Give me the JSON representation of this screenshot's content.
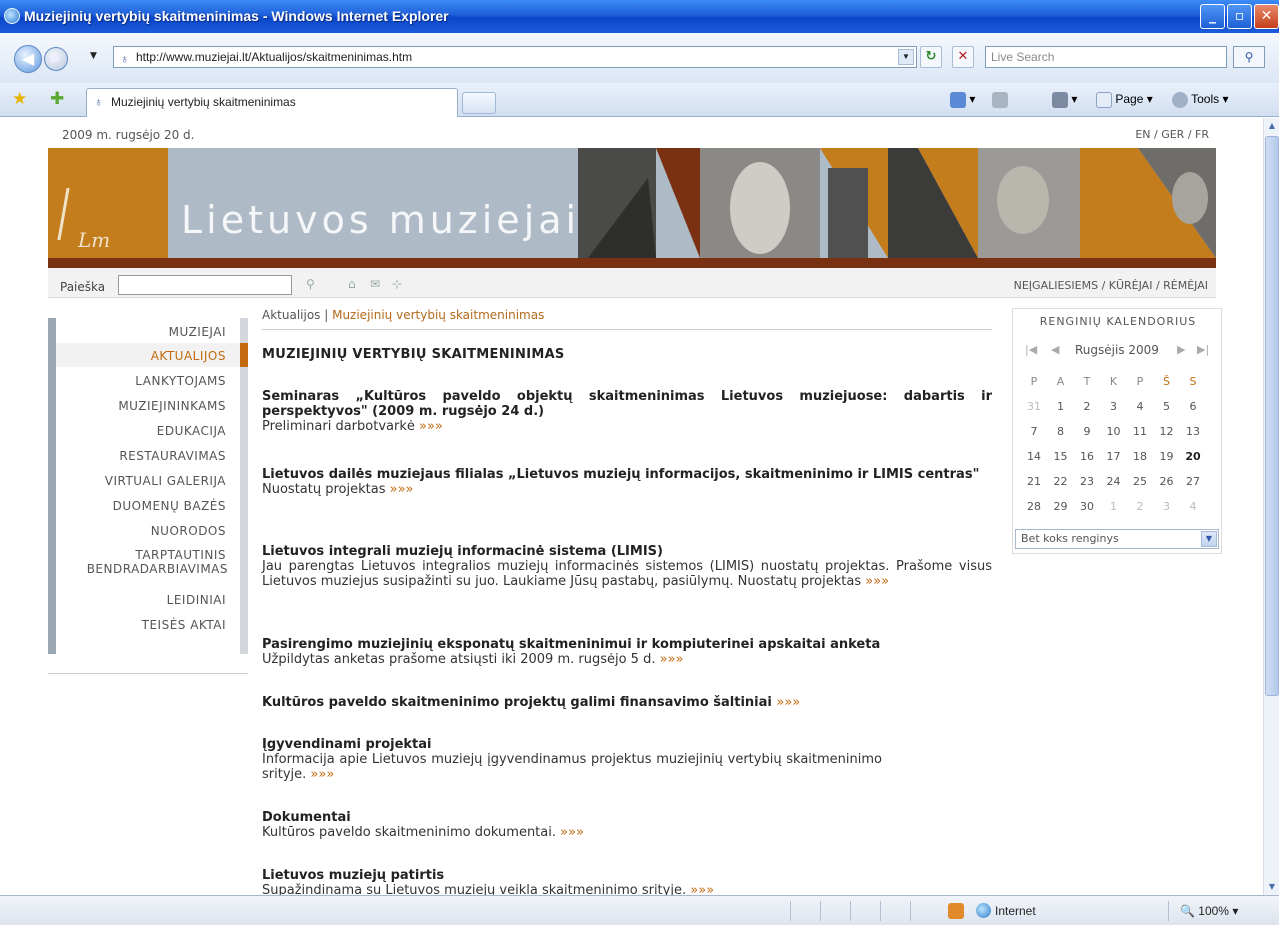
{
  "window": {
    "title": "Muziejinių vertybių skaitmeninimas - Windows Internet Explorer",
    "min_icon": "_",
    "max_icon": "▫",
    "close_icon": "✕"
  },
  "nav": {
    "back_icon": "◀",
    "forward_icon": "▶",
    "address": "http://www.muziejai.lt/Aktualijos/skaitmeninimas.htm",
    "refresh_icon": "↻",
    "stop_icon": "✕",
    "search_placeholder": "Live Search",
    "search_icon": "⚲"
  },
  "tabs": {
    "active_title": "Muziejinių vertybių skaitmeninimas",
    "commands": {
      "page": "Page",
      "tools": "Tools"
    }
  },
  "site": {
    "date": "2009 m. rugsėjo 20 d.",
    "languages": "EN / GER / FR",
    "name": "Lietuvos muziejai",
    "logo_mark": "Lm",
    "search_label": "Paieška",
    "search_value": "",
    "top_links": "NEĮGALIESIEMS / KŪRĖJAI / RĖMĖJAI"
  },
  "sidebar": {
    "items": [
      {
        "label": "MUZIEJAI"
      },
      {
        "label": "AKTUALIJOS"
      },
      {
        "label": "LANKYTOJAMS"
      },
      {
        "label": "MUZIEJININKAMS"
      },
      {
        "label": "EDUKACIJA"
      },
      {
        "label": "RESTAURAVIMAS"
      },
      {
        "label": "VIRTUALI GALERIJA"
      },
      {
        "label": "DUOMENŲ BAZĖS"
      },
      {
        "label": "NUORODOS"
      },
      {
        "label": "TARPTAUTINIS"
      },
      {
        "label": "BENDRADARBIAVIMAS"
      },
      {
        "label": "LEIDINIAI"
      },
      {
        "label": "TEISĖS AKTAI"
      }
    ]
  },
  "content": {
    "breadcrumb_home": "Aktualijos",
    "breadcrumb_sep": " | ",
    "breadcrumb_current": "Muziejinių vertybių skaitmeninimas",
    "heading": "MUZIEJINIŲ VERTYBIŲ SKAITMENINIMAS",
    "more": "»»»",
    "articles": [
      {
        "title": "Seminaras „Kultūros paveldo objektų skaitmeninimas Lietuvos muziejuose: dabartis ir perspektyvos\" (2009 m. rugsėjo 24 d.)",
        "desc": "Preliminari darbotvarkė"
      },
      {
        "title": "Lietuvos dailės muziejaus filialas „Lietuvos muziejų informacijos, skaitmeninimo ir LIMIS centras\"",
        "desc": "Nuostatų projektas"
      },
      {
        "title": "Lietuvos integrali muziejų informacinė sistema (LIMIS)",
        "desc": "Jau parengtas Lietuvos integralios muziejų informacinės sistemos (LIMIS) nuostatų projektas. Prašome visus Lietuvos muziejus susipažinti su juo. Laukiame Jūsų pastabų, pasiūlymų. Nuostatų projektas"
      },
      {
        "title": "Pasirengimo muziejinių eksponatų skaitmeninimui ir kompiuterinei apskaitai anketa",
        "desc": "Užpildytas anketas prašome atsiųsti iki 2009 m. rugsėjo 5 d."
      },
      {
        "title": "Kultūros paveldo skaitmeninimo projektų galimi finansavimo šaltiniai",
        "desc": ""
      },
      {
        "title": "Įgyvendinami projektai",
        "desc": "Informacija apie Lietuvos muziejų įgyvendinamus projektus muziejinių vertybių skaitmeninimo srityje."
      },
      {
        "title": "Dokumentai",
        "desc": "Kultūros paveldo skaitmeninimo dokumentai."
      },
      {
        "title": "Lietuvos muziejų patirtis",
        "desc": "Supažindinama su Lietuvos muziejų veikla skaitmeninimo srityje."
      }
    ]
  },
  "calendar": {
    "title": "RENGINIŲ KALENDORIUS",
    "month": "Rugsėjis 2009",
    "first_icon": "|◀",
    "prev_icon": "◀",
    "next_icon": "▶",
    "last_icon": "▶|",
    "weekdays": [
      "P",
      "A",
      "T",
      "K",
      "P",
      "Š",
      "S"
    ],
    "weeks": [
      [
        "31",
        "1",
        "2",
        "3",
        "4",
        "5",
        "6"
      ],
      [
        "7",
        "8",
        "9",
        "10",
        "11",
        "12",
        "13"
      ],
      [
        "14",
        "15",
        "16",
        "17",
        "18",
        "19",
        "20"
      ],
      [
        "21",
        "22",
        "23",
        "24",
        "25",
        "26",
        "27"
      ],
      [
        "28",
        "29",
        "30",
        "1",
        "2",
        "3",
        "4"
      ]
    ],
    "today": "20",
    "event_filter": "Bet koks renginys"
  },
  "status": {
    "zone": "Internet",
    "zoom": "100%"
  },
  "colors": {
    "accent": "#c36a10",
    "banner_gray": "#aebbc7",
    "banner_stripe": "#7a3111"
  }
}
